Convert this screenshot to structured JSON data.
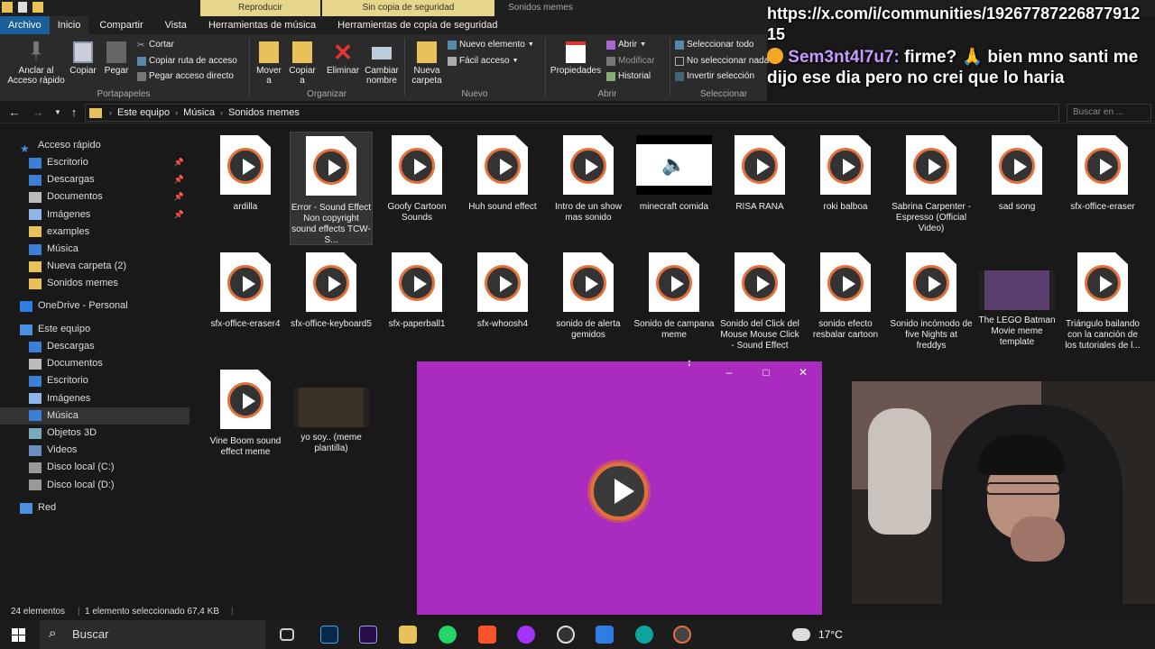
{
  "window": {
    "ctx_tabs": {
      "play": "Reproducir",
      "nobackup": "Sin copia de seguridad",
      "title": "Sonidos memes"
    },
    "ribbon_tabs": [
      "Archivo",
      "Inicio",
      "Compartir",
      "Vista",
      "Herramientas de música",
      "Herramientas de copia de seguridad"
    ]
  },
  "ribbon": {
    "clipboard": {
      "pin": "Anclar al Acceso rápido",
      "copy": "Copiar",
      "paste": "Pegar",
      "cut": "Cortar",
      "copy_path": "Copiar ruta de acceso",
      "paste_shortcut": "Pegar acceso directo",
      "label": "Portapapeles"
    },
    "organize": {
      "move": "Mover a",
      "copy_to": "Copiar a",
      "delete": "Eliminar",
      "rename": "Cambiar nombre",
      "label": "Organizar"
    },
    "new": {
      "new_folder": "Nueva carpeta",
      "new_item": "Nuevo elemento",
      "easy_access": "Fácil acceso",
      "label": "Nuevo"
    },
    "open": {
      "properties": "Propiedades",
      "open": "Abrir",
      "edit": "Modificar",
      "history": "Historial",
      "label": "Abrir"
    },
    "select": {
      "select_all": "Seleccionar todo",
      "select_none": "No seleccionar nada",
      "invert": "Invertir selección",
      "label": "Seleccionar"
    }
  },
  "address": {
    "crumbs": [
      "Este equipo",
      "Música",
      "Sonidos memes"
    ],
    "search_placeholder": "Buscar en ..."
  },
  "nav": {
    "quick_access": "Acceso rápido",
    "quick_items": [
      "Escritorio",
      "Descargas",
      "Documentos",
      "Imágenes",
      "examples",
      "Música",
      "Nueva carpeta (2)",
      "Sonidos memes"
    ],
    "onedrive": "OneDrive - Personal",
    "this_pc": "Este equipo",
    "pc_items": [
      "Descargas",
      "Documentos",
      "Escritorio",
      "Imágenes",
      "Música",
      "Objetos 3D",
      "Videos",
      "Disco local (C:)",
      "Disco local (D:)"
    ],
    "network": "Red"
  },
  "files": [
    {
      "name": "ardilla",
      "kind": "audio"
    },
    {
      "name": "Error - Sound Effect  Non copyright sound effects  TCW-S...",
      "kind": "audio"
    },
    {
      "name": "Goofy Cartoon Sounds",
      "kind": "audio"
    },
    {
      "name": "Huh sound effect",
      "kind": "audio"
    },
    {
      "name": "Intro de un show mas sonido",
      "kind": "audio"
    },
    {
      "name": "minecraft comida",
      "kind": "speaker"
    },
    {
      "name": "RISA RANA",
      "kind": "audio"
    },
    {
      "name": "roki balboa",
      "kind": "audio"
    },
    {
      "name": "Sabrina Carpenter - Espresso (Official Video)",
      "kind": "audio"
    },
    {
      "name": "sad song",
      "kind": "audio"
    },
    {
      "name": "sfx-office-eraser",
      "kind": "audio"
    },
    {
      "name": "sfx-office-eraser4",
      "kind": "audio"
    },
    {
      "name": "sfx-office-keyboard5",
      "kind": "audio"
    },
    {
      "name": "sfx-paperball1",
      "kind": "audio"
    },
    {
      "name": "sfx-whoosh4",
      "kind": "audio"
    },
    {
      "name": "sonido de alerta gemidos",
      "kind": "audio"
    },
    {
      "name": "Sonido de campana meme",
      "kind": "audio"
    },
    {
      "name": "Sonido del Click del Mouse  Mouse Click - Sound Effect",
      "kind": "audio"
    },
    {
      "name": "sonido efecto resbalar cartoon",
      "kind": "audio"
    },
    {
      "name": "Sonido incómodo de five Nights at freddys",
      "kind": "audio"
    },
    {
      "name": "The LEGO Batman Movie meme template",
      "kind": "video"
    },
    {
      "name": "Triángulo bailando con la canción de los tutoriales de l...",
      "kind": "audio"
    },
    {
      "name": "Vine Boom sound effect meme",
      "kind": "audio"
    },
    {
      "name": "yo soy.. (meme plantilla)",
      "kind": "video"
    }
  ],
  "status": {
    "count": "24 elementos",
    "selected": "1 elemento seleccionado  67,4 KB"
  },
  "taskbar": {
    "search": "Buscar",
    "temp": "17°C"
  },
  "chat": {
    "line1": "https://x.com/i/communities/1926778722687791215",
    "user": "Sem3nt4l7u7:",
    "message": "firme? 🙏 bien mno santi me dijo ese dia pero no crei que lo haria"
  },
  "colors": {
    "file_tab": "#1b5e9c",
    "context_tab": "#e6d58a",
    "player_bg": "#a92bc0",
    "play_ring": "#e2703a"
  }
}
